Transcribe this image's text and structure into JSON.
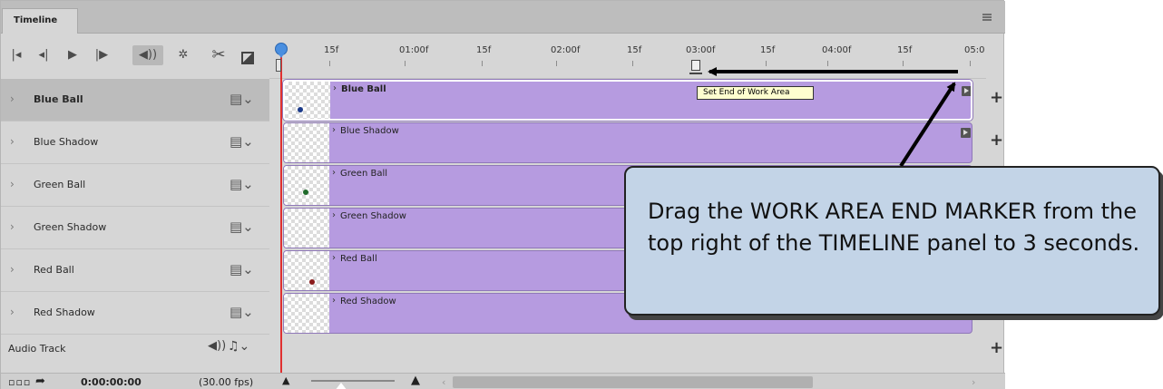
{
  "panel": {
    "tab_title": "Timeline"
  },
  "toolbar": {
    "buttons": [
      {
        "name": "go-to-first-frame",
        "glyph": "|◂"
      },
      {
        "name": "previous-frame",
        "glyph": "◂|"
      },
      {
        "name": "play",
        "glyph": "▶"
      },
      {
        "name": "next-frame",
        "glyph": "|▶"
      },
      {
        "name": "audio",
        "glyph": "◀))"
      },
      {
        "name": "settings",
        "glyph": "✲"
      },
      {
        "name": "split",
        "glyph": "✂"
      }
    ]
  },
  "ruler": {
    "labels": [
      "15f",
      "01:00f",
      "15f",
      "02:00f",
      "15f",
      "03:00f",
      "15f",
      "04:00f",
      "15f",
      "05:0"
    ]
  },
  "layers": [
    {
      "name": "Blue Ball",
      "dot": "#1a3a8a",
      "selected": true
    },
    {
      "name": "Blue Shadow",
      "dot": "",
      "selected": false
    },
    {
      "name": "Green Ball",
      "dot": "#1f6a2a",
      "selected": false
    },
    {
      "name": "Green Shadow",
      "dot": "",
      "selected": false
    },
    {
      "name": "Red Ball",
      "dot": "#8a1a1a",
      "selected": false
    },
    {
      "name": "Red Shadow",
      "dot": "",
      "selected": false
    }
  ],
  "audio_track": {
    "label": "Audio Track"
  },
  "status": {
    "timecode": "0:00:00:00",
    "fps": "(30.00 fps)"
  },
  "tooltip": "Set End of Work Area",
  "callout": {
    "text": "Drag the WORK AREA END MARKER from the top right of the TIMELINE panel to 3 seconds."
  },
  "colors": {
    "clip": "#b69be0",
    "playhead": "#e03030",
    "callout_bg": "#c3d4e7",
    "tooltip_bg": "#fefecf"
  },
  "icons": [
    "menu-icon",
    "play-icon",
    "scissors-icon",
    "gear-icon",
    "speaker-icon",
    "film-icon",
    "music-note-icon",
    "add-icon"
  ]
}
